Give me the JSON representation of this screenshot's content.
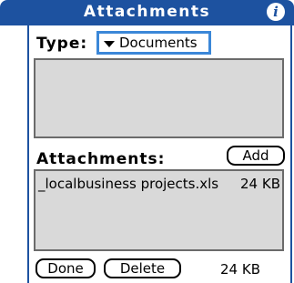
{
  "window": {
    "title": "Attachments",
    "info_icon": "i",
    "accent_color": "#1d52a0"
  },
  "type_field": {
    "label": "Type:",
    "selected": "Documents",
    "caret_icon": "triangle-down-icon"
  },
  "attachments": {
    "label": "Attachments:",
    "add_label": "Add",
    "items": [
      {
        "name": "_localbusiness projects.xls",
        "size": "24 KB"
      }
    ]
  },
  "footer": {
    "done_label": "Done",
    "delete_label": "Delete",
    "total_size": "24 KB"
  }
}
